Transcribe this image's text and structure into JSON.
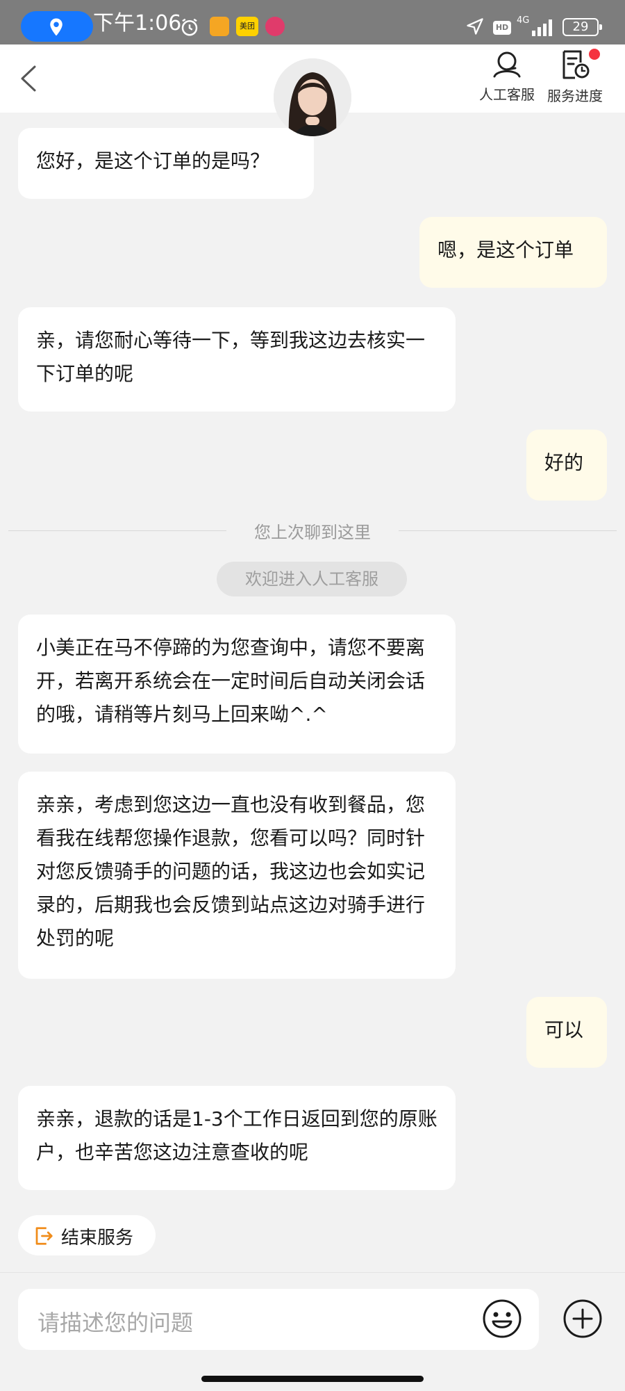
{
  "status_bar": {
    "time": "下午1:06",
    "battery": "29",
    "network": "4G",
    "hd": "HD",
    "meituan": "美团"
  },
  "header": {
    "customer_service_label": "人工客服",
    "progress_label": "服务进度"
  },
  "messages": [
    {
      "from": "agent",
      "text": "您好，是这个订单的是吗？"
    },
    {
      "from": "user",
      "text": "嗯，是这个订单"
    },
    {
      "from": "agent",
      "text": "亲，请您耐心等待一下，等到我这边去核实一下订单的呢"
    },
    {
      "from": "user",
      "text": "好的"
    },
    {
      "from": "agent",
      "text": "小美正在马不停蹄的为您查询中，请您不要离开，若离开系统会在一定时间后自动关闭会话的哦，请稍等片刻马上回来呦^.^"
    },
    {
      "from": "agent",
      "text": "亲亲，考虑到您这边一直也没有收到餐品，您看我在线帮您操作退款，您看可以吗？同时针对您反馈骑手的问题的话，我这边也会如实记录的，后期我也会反馈到站点这边对骑手进行处罚的呢"
    },
    {
      "from": "user",
      "text": "可以"
    },
    {
      "from": "agent",
      "text": "亲亲，退款的话是1-3个工作日返回到您的原账户，也辛苦您这边注意查收的呢"
    }
  ],
  "divider": {
    "text": "您上次聊到这里"
  },
  "system_notice": {
    "text": "欢迎进入人工客服"
  },
  "end_service": {
    "label": "结束服务"
  },
  "input": {
    "placeholder": "请描述您的问题"
  },
  "colors": {
    "agent_bubble": "#ffffff",
    "user_bubble": "#fffbe9",
    "background": "#f2f2f2",
    "status_bar": "#7d7d7d",
    "location_pill": "#1677ff",
    "accent_orange": "#f08c1a",
    "notification_dot": "#f5333f"
  }
}
